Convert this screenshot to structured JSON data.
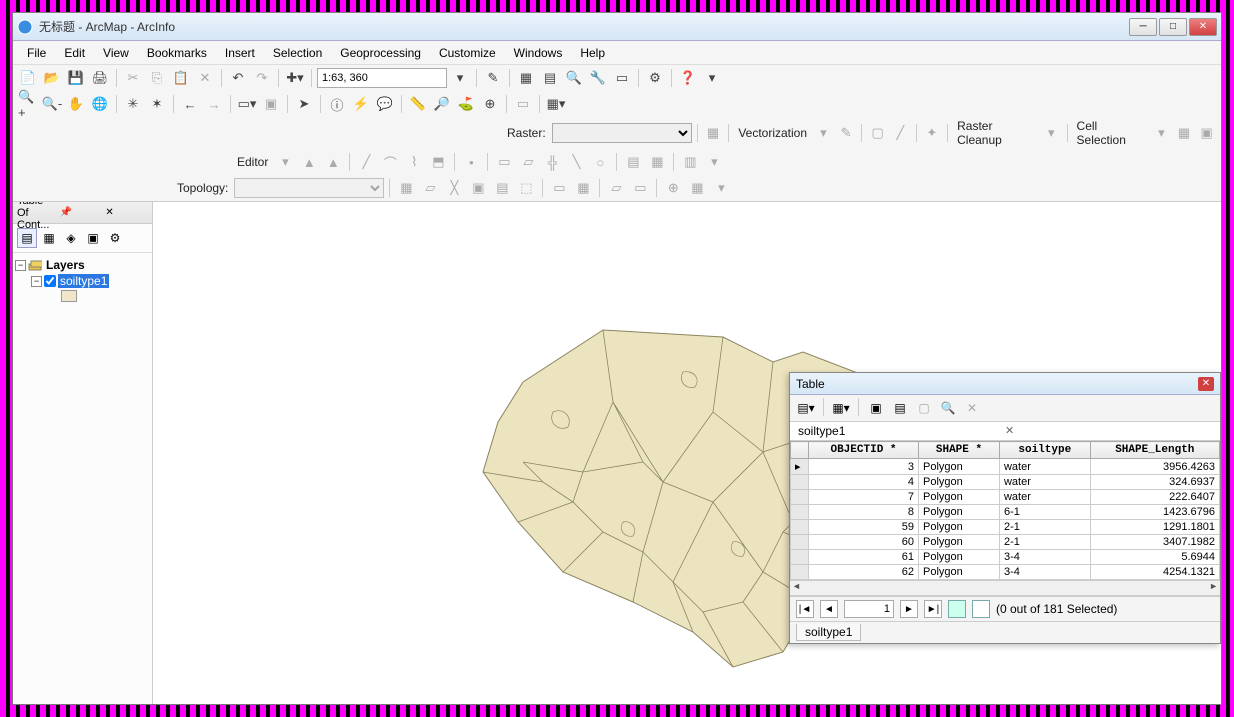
{
  "window": {
    "title": "无标题 - ArcMap - ArcInfo"
  },
  "menus": [
    "File",
    "Edit",
    "View",
    "Bookmarks",
    "Insert",
    "Selection",
    "Geoprocessing",
    "Customize",
    "Windows",
    "Help"
  ],
  "toolbar1": {
    "scale": "1:63, 360"
  },
  "raster_label": "Raster:",
  "vectorization_label": "Vectorization",
  "raster_cleanup_label": "Raster Cleanup",
  "cell_selection_label": "Cell Selection",
  "editor_label": "Editor",
  "topology_label": "Topology:",
  "toc": {
    "title": "Table Of Cont...",
    "root": "Layers",
    "layer": "soiltype1"
  },
  "table": {
    "title": "Table",
    "layer_name": "soiltype1",
    "columns": [
      "OBJECTID *",
      "SHAPE *",
      "soiltype",
      "SHAPE_Length"
    ],
    "rows": [
      {
        "objectid": "3",
        "shape": "Polygon",
        "soiltype": "water",
        "length": "3956.4263"
      },
      {
        "objectid": "4",
        "shape": "Polygon",
        "soiltype": "water",
        "length": "324.6937"
      },
      {
        "objectid": "7",
        "shape": "Polygon",
        "soiltype": "water",
        "length": "222.6407"
      },
      {
        "objectid": "8",
        "shape": "Polygon",
        "soiltype": "6-1",
        "length": "1423.6796"
      },
      {
        "objectid": "59",
        "shape": "Polygon",
        "soiltype": "2-1",
        "length": "1291.1801"
      },
      {
        "objectid": "60",
        "shape": "Polygon",
        "soiltype": "2-1",
        "length": "3407.1982"
      },
      {
        "objectid": "61",
        "shape": "Polygon",
        "soiltype": "3-4",
        "length": "5.6944"
      },
      {
        "objectid": "62",
        "shape": "Polygon",
        "soiltype": "3-4",
        "length": "4254.1321"
      }
    ],
    "nav_record": "1",
    "selection_status": "(0 out of 181 Selected)",
    "bottom_tab": "soiltype1"
  }
}
